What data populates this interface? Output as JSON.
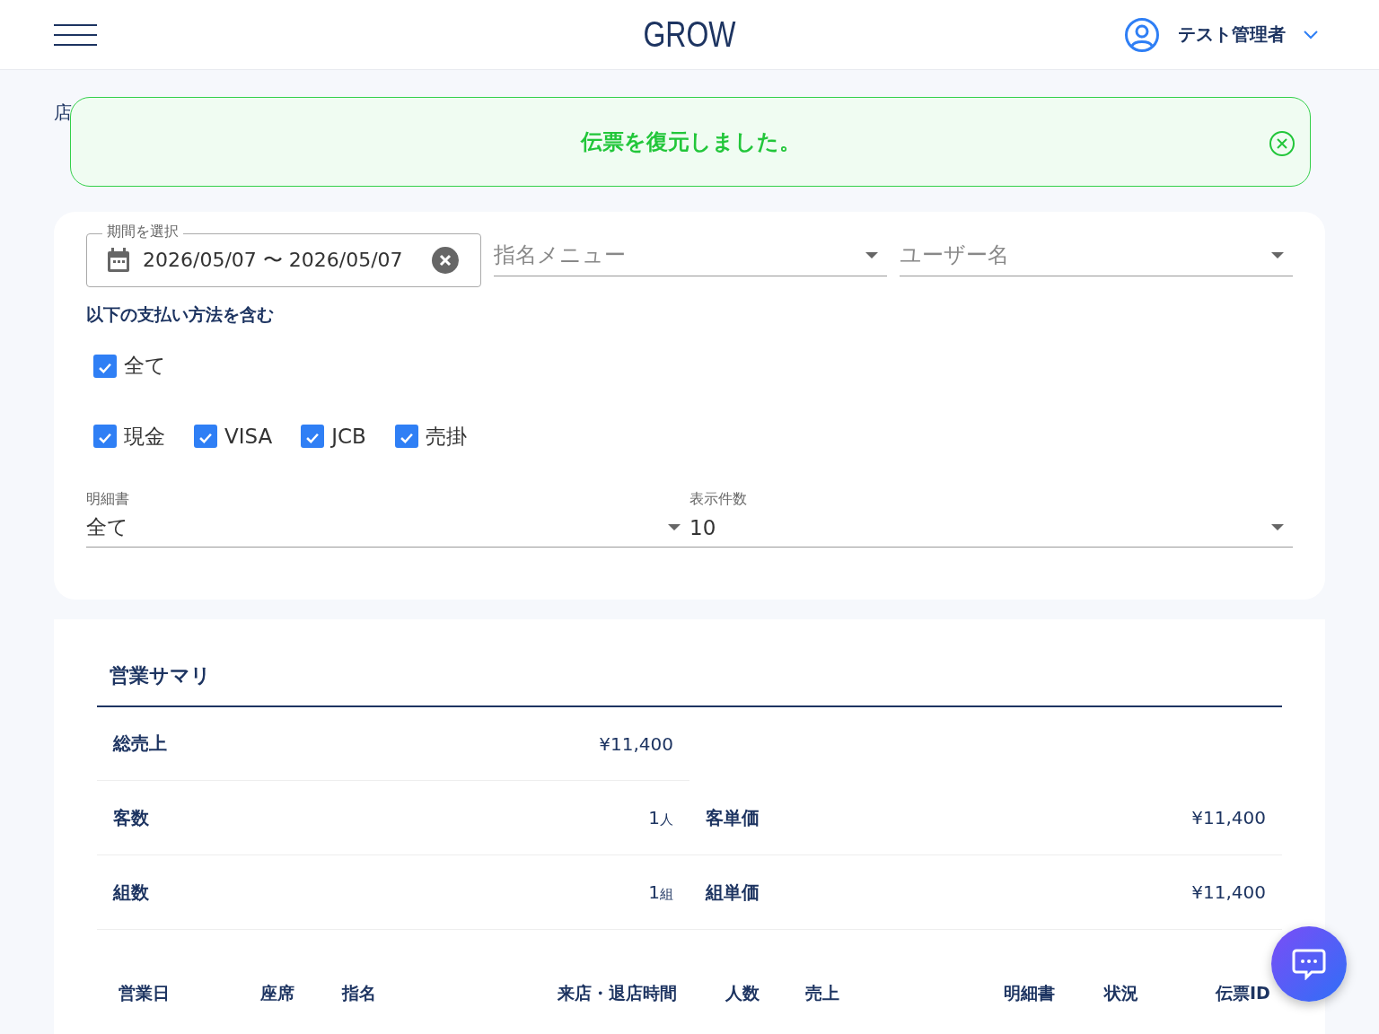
{
  "header": {
    "logo": "GROW",
    "user_name": "テスト管理者"
  },
  "page": {
    "breadcrumb": "店"
  },
  "toast": {
    "message": "伝票を復元しました。"
  },
  "filters": {
    "date_range": {
      "label": "期間を選択",
      "value": "2026/05/07 〜 2026/05/07"
    },
    "nominee_menu": {
      "placeholder": "指名メニュー"
    },
    "user_name": {
      "placeholder": "ユーザー名"
    },
    "payment_heading": "以下の支払い方法を含む",
    "all_payments": {
      "label": "全て",
      "checked": true
    },
    "payments": [
      {
        "label": "現金",
        "checked": true
      },
      {
        "label": "VISA",
        "checked": true
      },
      {
        "label": "JCB",
        "checked": true
      },
      {
        "label": "売掛",
        "checked": true
      }
    ],
    "statement": {
      "label": "明細書",
      "value": "全て"
    },
    "page_size": {
      "label": "表示件数",
      "value": "10"
    }
  },
  "summary": {
    "title": "営業サマリ",
    "total_sales": {
      "label": "総売上",
      "value": "¥11,400"
    },
    "rows": [
      {
        "label": "客数",
        "value": "1",
        "unit": "人",
        "avg_label": "客単価",
        "avg_value": "¥11,400"
      },
      {
        "label": "組数",
        "value": "1",
        "unit": "組",
        "avg_label": "組単価",
        "avg_value": "¥11,400"
      }
    ]
  },
  "table": {
    "columns": [
      "営業日",
      "座席",
      "指名",
      "来店・退店時間",
      "人数",
      "売上",
      "明細書",
      "状況",
      "伝票ID"
    ]
  }
}
